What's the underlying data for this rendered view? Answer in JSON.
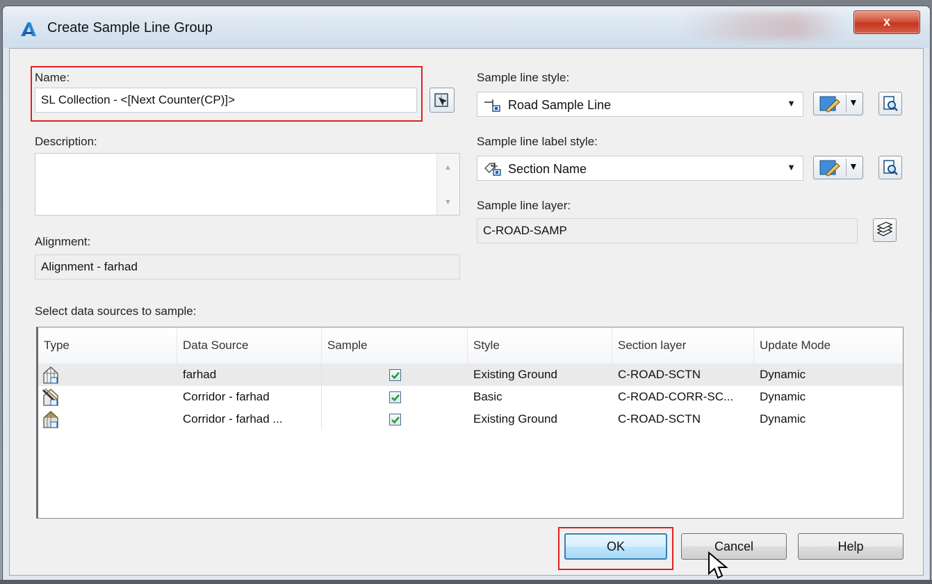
{
  "window": {
    "title": "Create Sample Line Group",
    "close_label": "x"
  },
  "form": {
    "name_label": "Name:",
    "name_value": "SL Collection - <[Next Counter(CP)]>",
    "description_label": "Description:",
    "description_value": "",
    "alignment_label": "Alignment:",
    "alignment_value": "Alignment - farhad",
    "sample_line_style_label": "Sample line style:",
    "sample_line_style_value": "Road Sample Line",
    "sample_line_label_style_label": "Sample line label style:",
    "sample_line_label_style_value": "Section Name",
    "sample_line_layer_label": "Sample line layer:",
    "sample_line_layer_value": "C-ROAD-SAMP"
  },
  "sources": {
    "label": "Select data sources to sample:",
    "columns": [
      "Type",
      "Data Source",
      "Sample",
      "Style",
      "Section layer",
      "Update Mode"
    ],
    "rows": [
      {
        "type_icon": "surface-icon",
        "data_source": "farhad",
        "sample": true,
        "style": "Existing Ground",
        "section_layer": "C-ROAD-SCTN",
        "update_mode": "Dynamic"
      },
      {
        "type_icon": "corridor-icon",
        "data_source": "Corridor - farhad",
        "sample": true,
        "style": "Basic",
        "section_layer": "C-ROAD-CORR-SC...",
        "update_mode": "Dynamic"
      },
      {
        "type_icon": "corridor-surface-icon",
        "data_source": "Corridor - farhad ...",
        "sample": true,
        "style": "Existing Ground",
        "section_layer": "C-ROAD-SCTN",
        "update_mode": "Dynamic"
      }
    ]
  },
  "buttons": {
    "ok": "OK",
    "cancel": "Cancel",
    "help": "Help"
  },
  "colors": {
    "highlight_box": "#e02020",
    "check": "#2a9a2a"
  }
}
